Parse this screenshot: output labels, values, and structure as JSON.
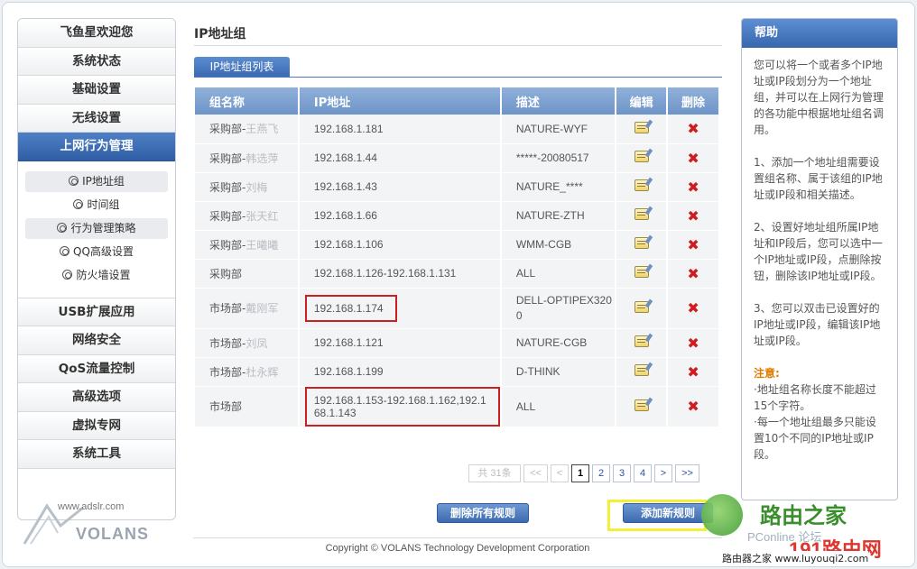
{
  "sidebar": {
    "items_top": [
      "飞鱼星欢迎您",
      "系统状态",
      "基础设置",
      "无线设置"
    ],
    "active_item": "上网行为管理",
    "submenu": [
      "IP地址组",
      "时间组",
      "行为管理策略",
      "QQ高级设置",
      "防火墙设置"
    ],
    "items_bottom": [
      "USB扩展应用",
      "网络安全",
      "QoS流量控制",
      "高级选项",
      "虚拟专网",
      "系统工具"
    ]
  },
  "logo": {
    "url": "www.adslr.com",
    "brand": "VOLANS"
  },
  "page": {
    "title": "IP地址组",
    "tab": "IP地址组列表"
  },
  "table": {
    "headers": [
      "组名称",
      "IP地址",
      "描述",
      "编辑",
      "删除"
    ],
    "rows": [
      {
        "name": "采购部-",
        "name_blur": "王燕飞",
        "ip": "192.168.1.181",
        "desc": "NATURE-WYF"
      },
      {
        "name": "采购部-",
        "name_blur": "韩选萍",
        "ip": "192.168.1.44",
        "desc": "*****-20080517"
      },
      {
        "name": "采购部-",
        "name_blur": "刘梅",
        "ip": "192.168.1.43",
        "desc": "NATURE_****"
      },
      {
        "name": "采购部-",
        "name_blur": "张天红",
        "ip": "192.168.1.66",
        "desc": "NATURE-ZTH"
      },
      {
        "name": "采购部-",
        "name_blur": "王曦曦",
        "ip": "192.168.1.106",
        "desc": "WMM-CGB"
      },
      {
        "name": "采购部",
        "name_blur": "",
        "ip": "192.168.1.126-192.168.1.131",
        "desc": "ALL"
      },
      {
        "name": "市场部-",
        "name_blur": "戴刚军",
        "ip": "192.168.1.174",
        "desc": "DELL-OPTIPEX320",
        "desc2": "0"
      },
      {
        "name": "市场部-",
        "name_blur": "刘凤",
        "ip": "192.168.1.121",
        "desc": "NATURE-CGB"
      },
      {
        "name": "市场部-",
        "name_blur": "杜永辉",
        "ip": "192.168.1.199",
        "desc": "D-THINK"
      },
      {
        "name": "市场部",
        "name_blur": "",
        "ip": "192.168.1.153-192.168.1.162,192.1",
        "ip2": "68.1.143",
        "desc": "ALL"
      }
    ]
  },
  "pager": {
    "total": "共 31条",
    "first": "<<",
    "prev": "<",
    "pages": [
      "1",
      "2",
      "3",
      "4"
    ],
    "current": "1",
    "next": ">",
    "last": ">>"
  },
  "buttons": {
    "delete_all": "删除所有规则",
    "add": "添加新规则"
  },
  "copyright": "Copyright © VOLANS Technology Development Corporation",
  "help": {
    "title": "帮助",
    "p1": "您可以将一个或者多个IP地址或IP段划分为一个地址组，并可以在上网行为管理的各功能中根据地址组名调用。",
    "p2": "1、添加一个地址组需要设置组名称、属于该组的IP地址或IP段和相关描述。",
    "p3": "2、设置好地址组所属IP地址和IP段后，您可以选中一个IP地址或IP段，点删除按钮，删除该IP地址或IP段。",
    "p4": "3、您可以双击已设置好的IP地址或IP段，编辑该IP地址或IP段。",
    "note_title": "注意:",
    "note1": "·地址组名称长度不能超过15个字符。",
    "note2": "·每一个地址组最多只能设置10个不同的IP地址或IP段。"
  },
  "watermark": {
    "site": "路由之家",
    "pconline": "PConline 论坛",
    "num": "191路由网",
    "bottom": "路由器之家 www.luyouqi2.com"
  },
  "colors": {
    "accent": "#3a6bb3",
    "highlight_red": "#cc1f1f",
    "highlight_yellow": "#f2ef36"
  }
}
